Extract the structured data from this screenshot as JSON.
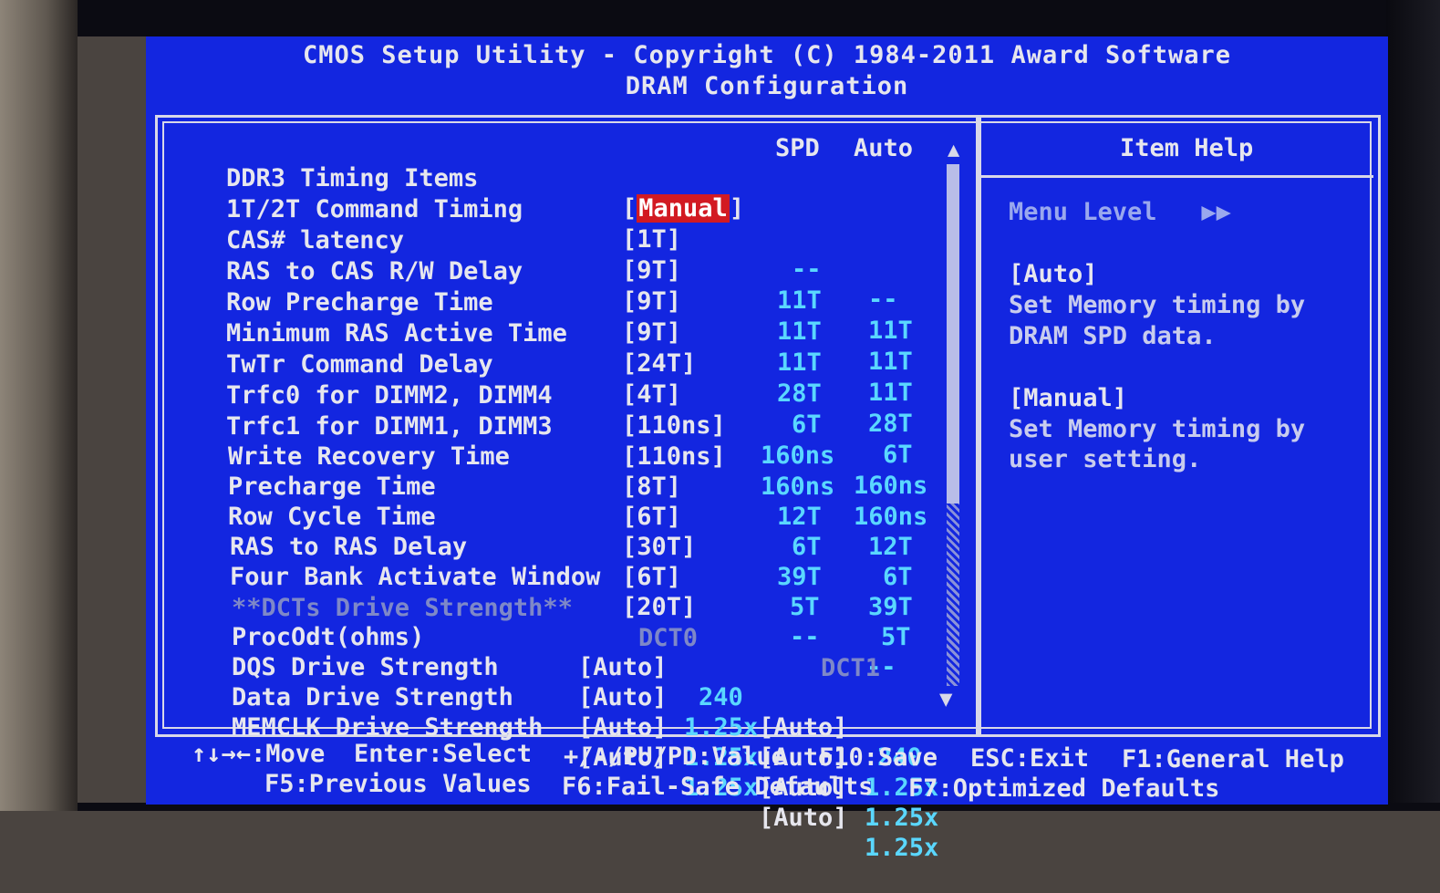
{
  "header": {
    "title": "CMOS Setup Utility - Copyright (C) 1984-2011 Award Software",
    "subtitle": "DRAM Configuration"
  },
  "columns": {
    "spd": "SPD",
    "auto": "Auto"
  },
  "rows": [
    {
      "label": "DDR3 Timing Items",
      "value": "[Manual]",
      "spd": "",
      "auto": "",
      "value_open": "[",
      "value_sel": "Manual",
      "value_close": "]"
    },
    {
      "label": "1T/2T Command Timing",
      "value": "[1T]",
      "spd": "--",
      "auto": "--"
    },
    {
      "label": "CAS# latency",
      "value": "[9T]",
      "spd": "11T",
      "auto": "11T"
    },
    {
      "label": "RAS to CAS R/W Delay",
      "value": "[9T]",
      "spd": "11T",
      "auto": "11T"
    },
    {
      "label": "Row Precharge Time",
      "value": "[9T]",
      "spd": "11T",
      "auto": "11T"
    },
    {
      "label": "Minimum RAS Active Time",
      "value": "[24T]",
      "spd": "28T",
      "auto": "28T"
    },
    {
      "label": "TwTr Command Delay",
      "value": "[4T]",
      "spd": "6T",
      "auto": "6T"
    },
    {
      "label": "Trfc0 for DIMM2, DIMM4",
      "value": "[110ns]",
      "spd": "160ns",
      "auto": "160ns"
    },
    {
      "label": "Trfc1 for DIMM1, DIMM3",
      "value": "[110ns]",
      "spd": "160ns",
      "auto": "160ns"
    },
    {
      "label": "Write Recovery Time",
      "value": "[8T]",
      "spd": "12T",
      "auto": "12T"
    },
    {
      "label": "Precharge Time",
      "value": "[6T]",
      "spd": "6T",
      "auto": "6T"
    },
    {
      "label": "Row Cycle Time",
      "value": "[30T]",
      "spd": "39T",
      "auto": "39T"
    },
    {
      "label": "RAS to RAS Delay",
      "value": "[6T]",
      "spd": "5T",
      "auto": "5T"
    },
    {
      "label": "Four Bank Activate Window",
      "value": "[20T]",
      "spd": "--",
      "auto": "--"
    }
  ],
  "drive_strength": {
    "header": "**DCTs Drive Strength**",
    "dct0": "DCT0",
    "dct1": "DCT1",
    "rows": [
      {
        "label": "ProcOdt(ohms)",
        "v0": "[Auto]",
        "r0": "240",
        "v1": "[Auto]",
        "r1": "240"
      },
      {
        "label": "DQS Drive Strength",
        "v0": "[Auto]",
        "r0": "1.25x",
        "v1": "[Auto]",
        "r1": "1.25x"
      },
      {
        "label": "Data Drive Strength",
        "v0": "[Auto]",
        "r0": "1.25x",
        "v1": "[Auto]",
        "r1": "1.25x"
      },
      {
        "label": "MEMCLK Drive Strength",
        "v0": "[Auto]",
        "r0": "1.25x",
        "v1": "[Auto]",
        "r1": "1.25x"
      }
    ]
  },
  "help": {
    "title": "Item Help",
    "menu_level": "Menu Level   ▶▶",
    "lines": [
      "[Auto]",
      "Set Memory timing by",
      "DRAM SPD data.",
      "",
      "[Manual]",
      "Set Memory timing by",
      "user setting."
    ]
  },
  "footer": {
    "line1": [
      "↑↓→←:Move",
      "Enter:Select",
      "+/-/PU/PD:Value",
      "F10:Save",
      "ESC:Exit",
      "F1:General Help"
    ],
    "line2": [
      "F5:Previous Values",
      "F6:Fail-Safe Defaults",
      "F7:Optimized Defaults"
    ]
  },
  "colors": {
    "background": "#1326e0",
    "text": "#e6e6ee",
    "value_cyan": "#5ad7ff",
    "highlight": "#d21a22"
  }
}
